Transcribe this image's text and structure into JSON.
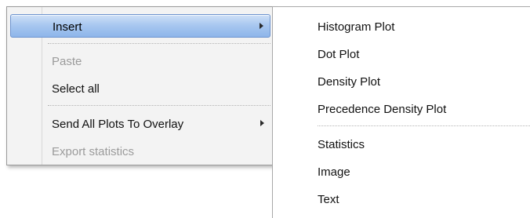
{
  "context_menu": {
    "items": [
      {
        "label": "Insert",
        "highlighted": true,
        "disabled": false,
        "submenu_icon": "chevron-right-icon"
      },
      {
        "label": "Paste",
        "disabled": true
      },
      {
        "label": "Select all",
        "disabled": false
      },
      {
        "label": "Send All Plots To Overlay",
        "disabled": false,
        "submenu_icon": "chevron-right-icon"
      },
      {
        "label": "Export statistics",
        "disabled": true
      }
    ],
    "highlight_color": "#a9c8f0"
  },
  "submenu": {
    "items": [
      {
        "label": "Histogram Plot"
      },
      {
        "label": "Dot Plot"
      },
      {
        "label": "Density Plot"
      },
      {
        "label": "Precedence Density Plot"
      },
      {
        "label": "Statistics"
      },
      {
        "label": "Image"
      },
      {
        "label": "Text"
      }
    ]
  }
}
